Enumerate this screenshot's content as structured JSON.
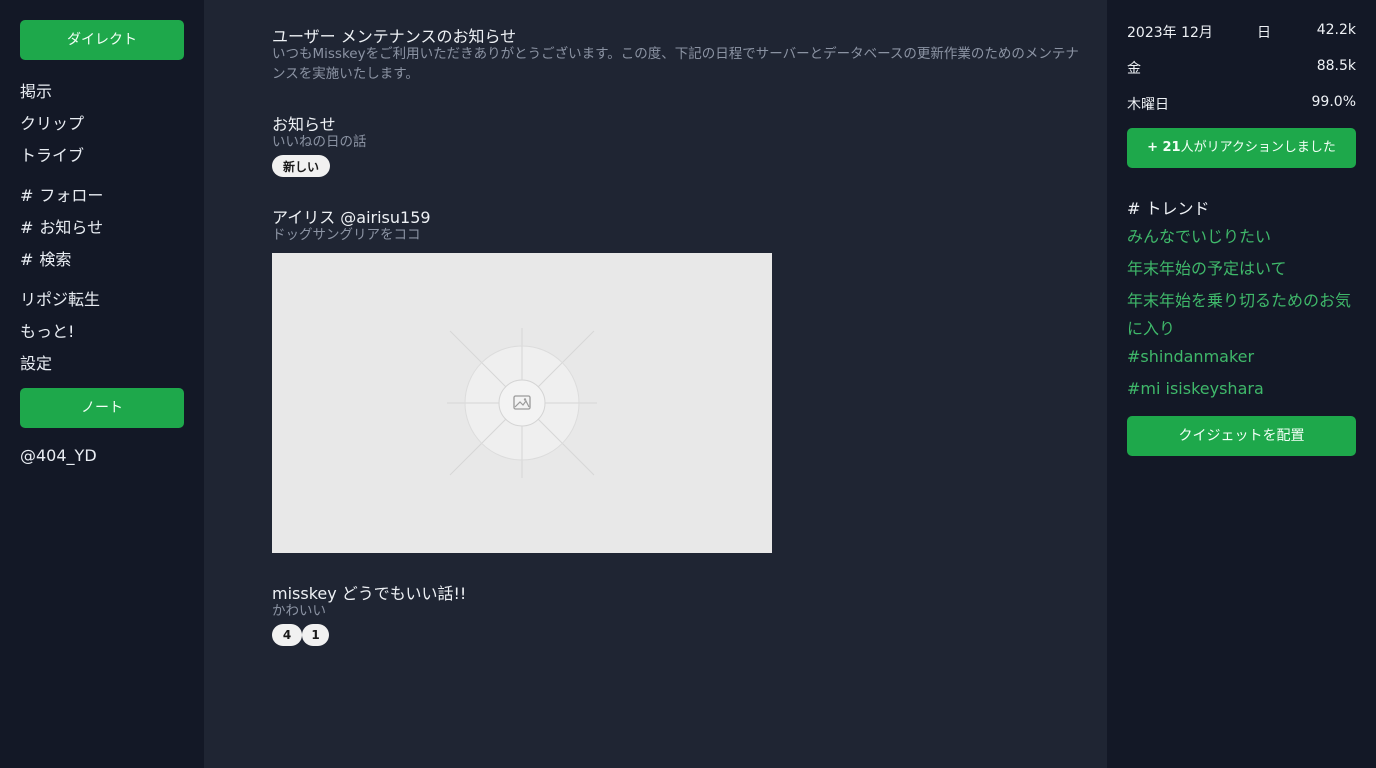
{
  "sidebar": {
    "direct_button": "ダイレクト",
    "nav_group1": [
      "掲示",
      "クリップ",
      "トライブ"
    ],
    "hash_items": [
      "フォロー",
      "お知らせ",
      "検索"
    ],
    "nav_group3": [
      "リポジ転生",
      "もっと!",
      "設定"
    ],
    "note_button": "ノート",
    "account": "@404_YD"
  },
  "main": {
    "post1": {
      "title": "ユーザー メンテナンスのお知らせ",
      "body": "いつもMisskeyをご利用いただきありがとうございます。この度、下記の日程でサーバーとデータベースの更新作業のためのメンテナンスを実施いたします。"
    },
    "post2": {
      "title": "お知らせ",
      "body": "いいねの日の話",
      "badge": "新しい"
    },
    "post3": {
      "title": "アイリス @airisu159",
      "body": "ドッグサングリアをココ"
    },
    "post4": {
      "title": "misskey どうでもいい話!!",
      "body": "かわいい",
      "badges": [
        "4",
        "1"
      ]
    }
  },
  "right": {
    "stats": {
      "date": "2023年 12月",
      "day_label": "日",
      "day_value": "42.2k",
      "fri_label": "金",
      "fri_value": "88.5k",
      "thu_label": "木曜日",
      "thu_value": "99.0%"
    },
    "reaction_button_prefix": "+ 21",
    "reaction_button_text": "人がリアクションしました",
    "trend_header": "トレンド",
    "trends": [
      "みんなでいじりたい",
      "年末年始の予定はいて",
      "年末年始を乗り切るためのお気に入り",
      "#shindanmaker",
      "#mi isiskeyshara"
    ],
    "widget_button": "クイジェットを配置"
  },
  "colors": {
    "accent": "#1ea84b",
    "link": "#3fb86a",
    "sidebar_bg": "#131826",
    "main_bg": "#1f2533"
  },
  "icons": {
    "image_placeholder": "image-icon",
    "hash": "hash-icon"
  }
}
